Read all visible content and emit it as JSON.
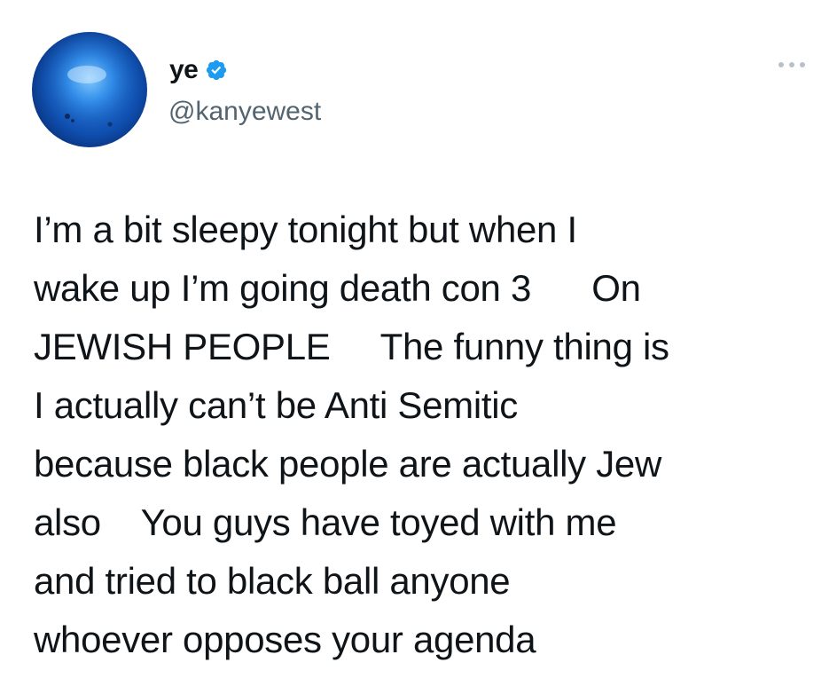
{
  "author": {
    "display_name": "ye",
    "handle": "@kanyewest",
    "verified": true,
    "avatar_icon": "blue-orb-avatar",
    "verified_icon": "verified-badge-icon",
    "verified_color": "#1d9bf0"
  },
  "menu": {
    "icon": "more-options-icon"
  },
  "tweet": {
    "lines": [
      "I’m a bit sleepy tonight but when I",
      "wake up I’m going death con 3      On",
      "JEWISH PEOPLE     The funny thing is",
      "I actually can’t be Anti Semitic",
      "because black people are actually Jew",
      "also    You guys have toyed with me",
      "and tried to black ball anyone",
      "whoever opposes your agenda"
    ]
  },
  "colors": {
    "text": "#0f1419",
    "secondary": "#536471",
    "background": "#ffffff"
  }
}
